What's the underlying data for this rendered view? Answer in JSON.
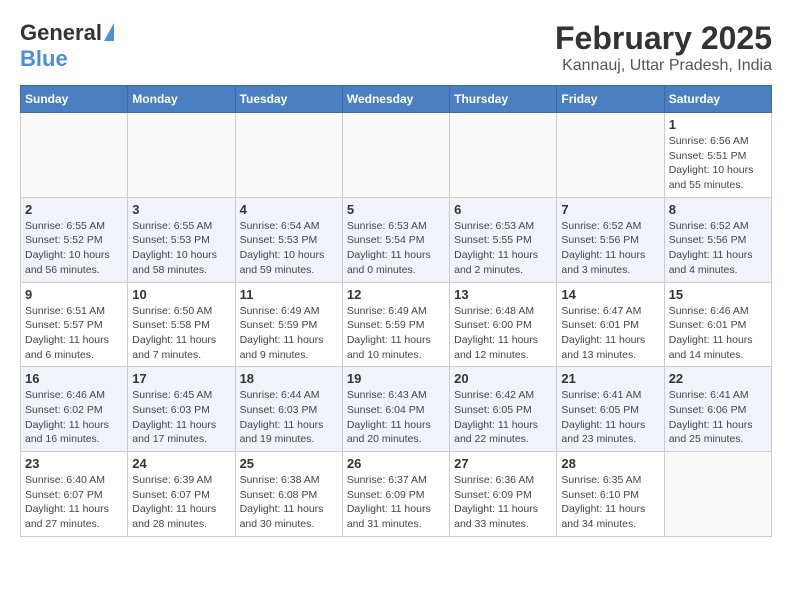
{
  "header": {
    "logo_general": "General",
    "logo_blue": "Blue",
    "month_title": "February 2025",
    "location": "Kannauj, Uttar Pradesh, India"
  },
  "days_of_week": [
    "Sunday",
    "Monday",
    "Tuesday",
    "Wednesday",
    "Thursday",
    "Friday",
    "Saturday"
  ],
  "weeks": [
    [
      {
        "day": "",
        "info": ""
      },
      {
        "day": "",
        "info": ""
      },
      {
        "day": "",
        "info": ""
      },
      {
        "day": "",
        "info": ""
      },
      {
        "day": "",
        "info": ""
      },
      {
        "day": "",
        "info": ""
      },
      {
        "day": "1",
        "info": "Sunrise: 6:56 AM\nSunset: 5:51 PM\nDaylight: 10 hours and 55 minutes."
      }
    ],
    [
      {
        "day": "2",
        "info": "Sunrise: 6:55 AM\nSunset: 5:52 PM\nDaylight: 10 hours and 56 minutes."
      },
      {
        "day": "3",
        "info": "Sunrise: 6:55 AM\nSunset: 5:53 PM\nDaylight: 10 hours and 58 minutes."
      },
      {
        "day": "4",
        "info": "Sunrise: 6:54 AM\nSunset: 5:53 PM\nDaylight: 10 hours and 59 minutes."
      },
      {
        "day": "5",
        "info": "Sunrise: 6:53 AM\nSunset: 5:54 PM\nDaylight: 11 hours and 0 minutes."
      },
      {
        "day": "6",
        "info": "Sunrise: 6:53 AM\nSunset: 5:55 PM\nDaylight: 11 hours and 2 minutes."
      },
      {
        "day": "7",
        "info": "Sunrise: 6:52 AM\nSunset: 5:56 PM\nDaylight: 11 hours and 3 minutes."
      },
      {
        "day": "8",
        "info": "Sunrise: 6:52 AM\nSunset: 5:56 PM\nDaylight: 11 hours and 4 minutes."
      }
    ],
    [
      {
        "day": "9",
        "info": "Sunrise: 6:51 AM\nSunset: 5:57 PM\nDaylight: 11 hours and 6 minutes."
      },
      {
        "day": "10",
        "info": "Sunrise: 6:50 AM\nSunset: 5:58 PM\nDaylight: 11 hours and 7 minutes."
      },
      {
        "day": "11",
        "info": "Sunrise: 6:49 AM\nSunset: 5:59 PM\nDaylight: 11 hours and 9 minutes."
      },
      {
        "day": "12",
        "info": "Sunrise: 6:49 AM\nSunset: 5:59 PM\nDaylight: 11 hours and 10 minutes."
      },
      {
        "day": "13",
        "info": "Sunrise: 6:48 AM\nSunset: 6:00 PM\nDaylight: 11 hours and 12 minutes."
      },
      {
        "day": "14",
        "info": "Sunrise: 6:47 AM\nSunset: 6:01 PM\nDaylight: 11 hours and 13 minutes."
      },
      {
        "day": "15",
        "info": "Sunrise: 6:46 AM\nSunset: 6:01 PM\nDaylight: 11 hours and 14 minutes."
      }
    ],
    [
      {
        "day": "16",
        "info": "Sunrise: 6:46 AM\nSunset: 6:02 PM\nDaylight: 11 hours and 16 minutes."
      },
      {
        "day": "17",
        "info": "Sunrise: 6:45 AM\nSunset: 6:03 PM\nDaylight: 11 hours and 17 minutes."
      },
      {
        "day": "18",
        "info": "Sunrise: 6:44 AM\nSunset: 6:03 PM\nDaylight: 11 hours and 19 minutes."
      },
      {
        "day": "19",
        "info": "Sunrise: 6:43 AM\nSunset: 6:04 PM\nDaylight: 11 hours and 20 minutes."
      },
      {
        "day": "20",
        "info": "Sunrise: 6:42 AM\nSunset: 6:05 PM\nDaylight: 11 hours and 22 minutes."
      },
      {
        "day": "21",
        "info": "Sunrise: 6:41 AM\nSunset: 6:05 PM\nDaylight: 11 hours and 23 minutes."
      },
      {
        "day": "22",
        "info": "Sunrise: 6:41 AM\nSunset: 6:06 PM\nDaylight: 11 hours and 25 minutes."
      }
    ],
    [
      {
        "day": "23",
        "info": "Sunrise: 6:40 AM\nSunset: 6:07 PM\nDaylight: 11 hours and 27 minutes."
      },
      {
        "day": "24",
        "info": "Sunrise: 6:39 AM\nSunset: 6:07 PM\nDaylight: 11 hours and 28 minutes."
      },
      {
        "day": "25",
        "info": "Sunrise: 6:38 AM\nSunset: 6:08 PM\nDaylight: 11 hours and 30 minutes."
      },
      {
        "day": "26",
        "info": "Sunrise: 6:37 AM\nSunset: 6:09 PM\nDaylight: 11 hours and 31 minutes."
      },
      {
        "day": "27",
        "info": "Sunrise: 6:36 AM\nSunset: 6:09 PM\nDaylight: 11 hours and 33 minutes."
      },
      {
        "day": "28",
        "info": "Sunrise: 6:35 AM\nSunset: 6:10 PM\nDaylight: 11 hours and 34 minutes."
      },
      {
        "day": "",
        "info": ""
      }
    ]
  ]
}
